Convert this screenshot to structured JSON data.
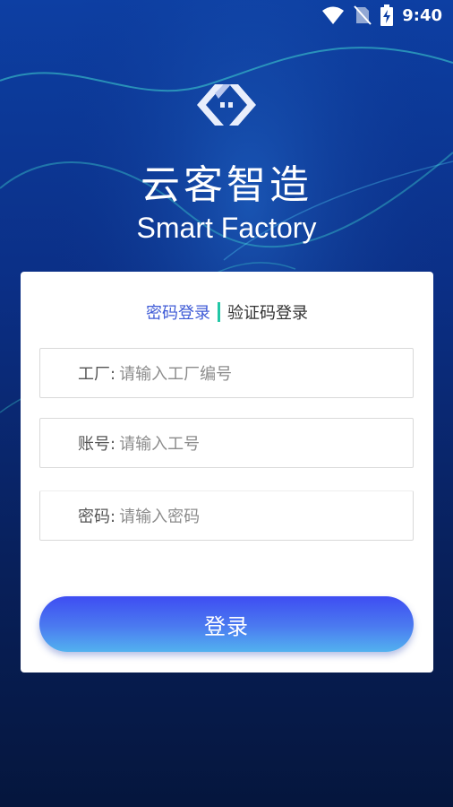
{
  "status_bar": {
    "time": "9:40",
    "icons": [
      "wifi-icon",
      "no-sim-icon",
      "battery-charging-icon"
    ]
  },
  "header": {
    "logo": "brand-logo-icon",
    "title": "云客智造",
    "subtitle": "Smart Factory"
  },
  "login": {
    "tabs": {
      "password_login": "密码登录",
      "code_login": "验证码登录",
      "active": "password_login"
    },
    "fields": {
      "factory_label": "工厂:",
      "factory_placeholder": "请输入工厂编号",
      "account_label": "账号:",
      "account_placeholder": "请输入工号",
      "password_label": "密码:",
      "password_placeholder": "请输入密码"
    },
    "submit_label": "登录"
  },
  "colors": {
    "accent": "#3f5bd6",
    "tab_divider": "#22c7a6",
    "button_top": "#3e4df2",
    "button_bottom": "#52b2ef",
    "background_top": "#0d3fa3",
    "background_bottom": "#05163d"
  }
}
